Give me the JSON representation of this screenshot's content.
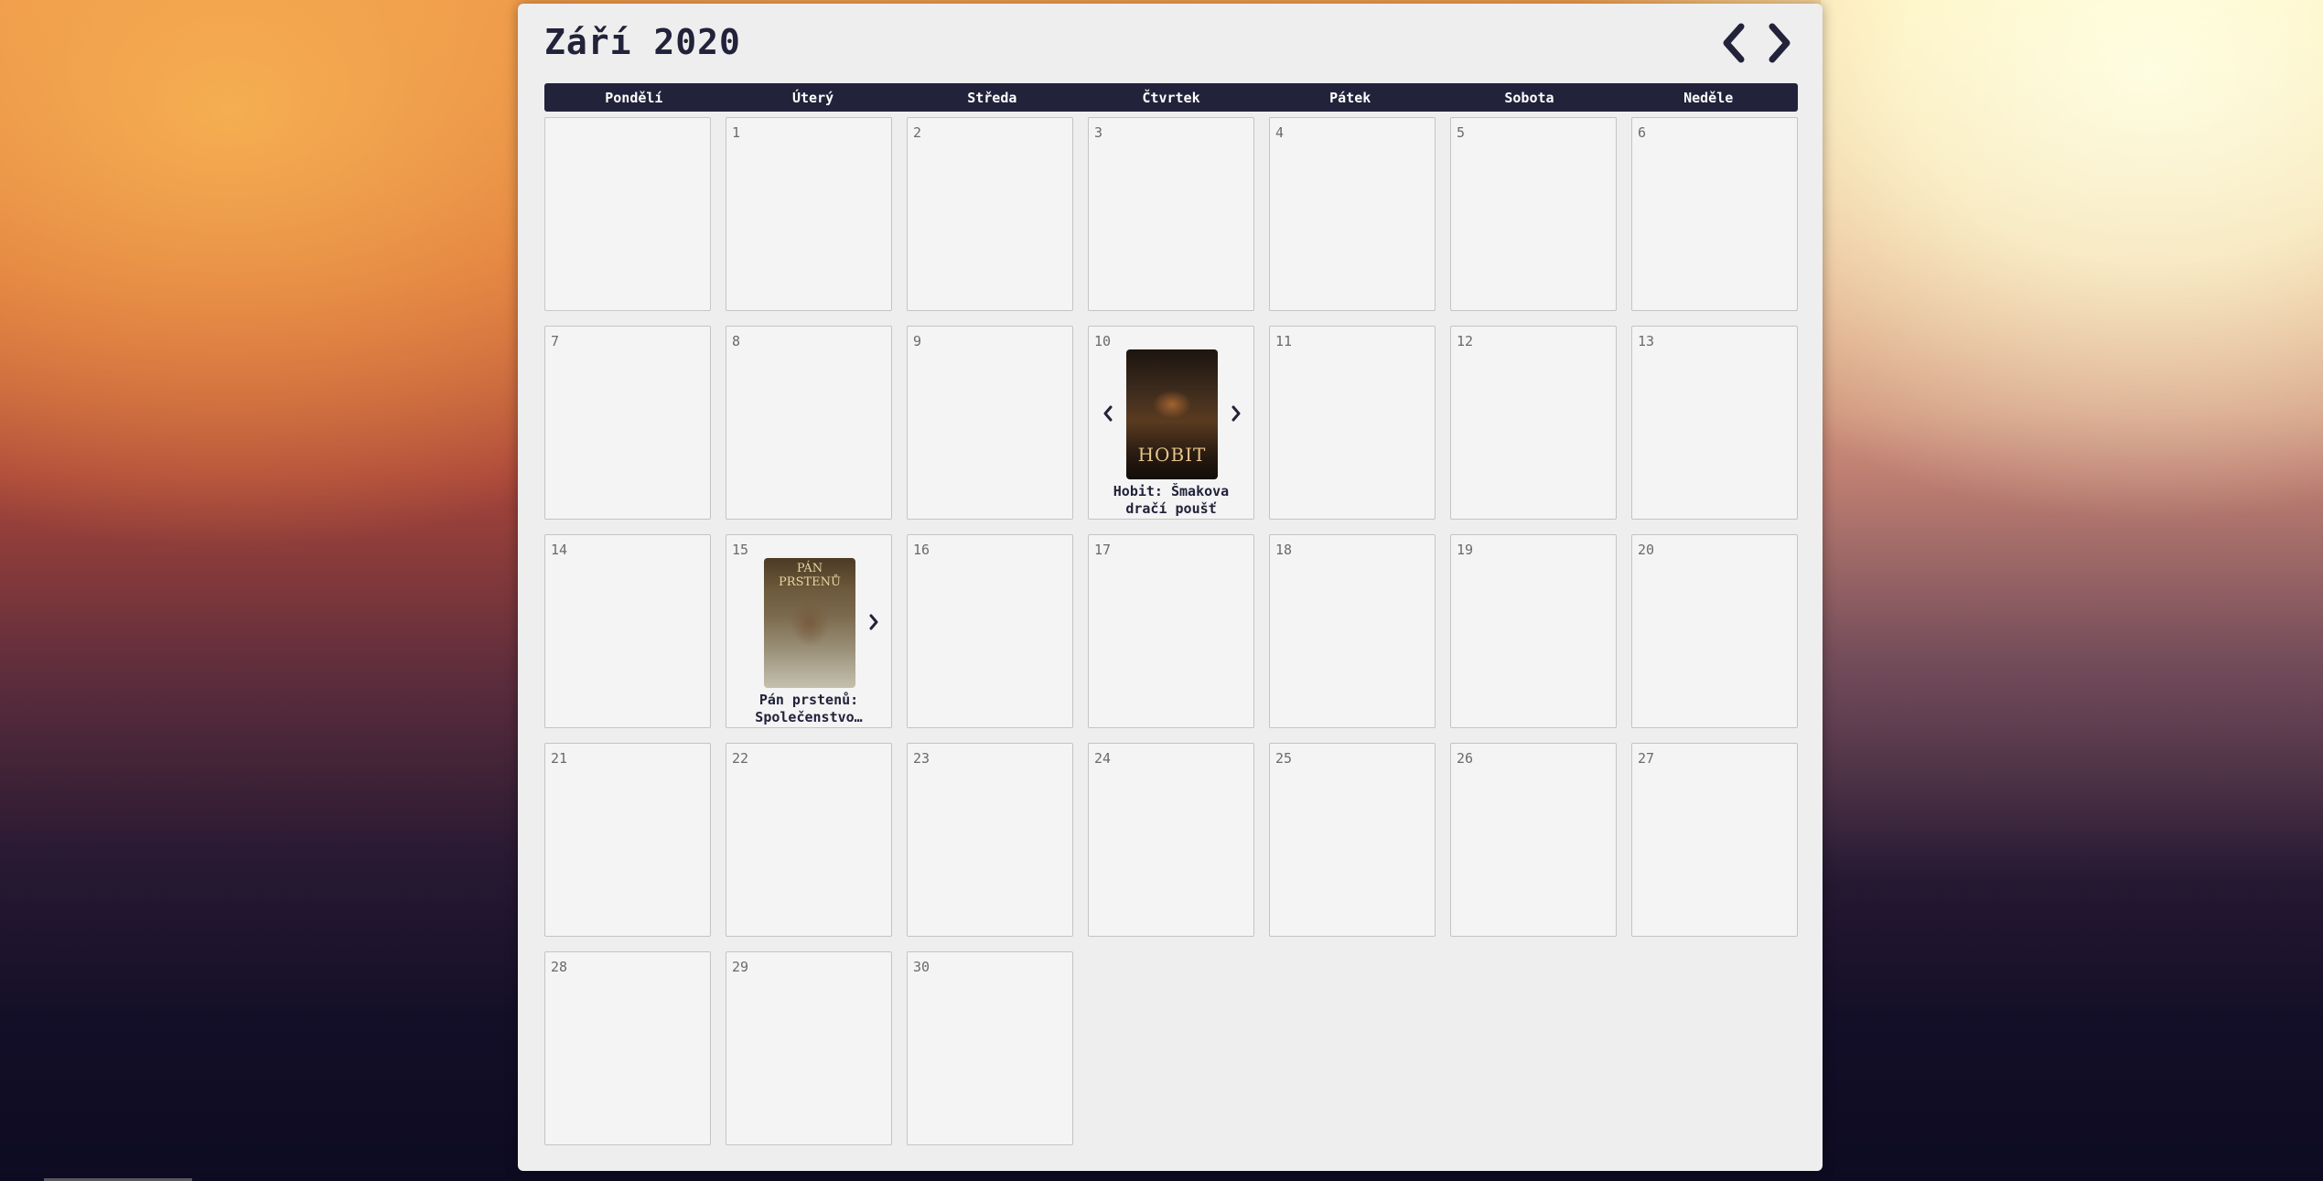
{
  "calendar": {
    "title": "Září 2020",
    "weekdays": [
      "Pondělí",
      "Úterý",
      "Středa",
      "Čtvrtek",
      "Pátek",
      "Sobota",
      "Neděle"
    ],
    "days": [
      "1",
      "2",
      "3",
      "4",
      "5",
      "6",
      "7",
      "8",
      "9",
      "10",
      "11",
      "12",
      "13",
      "14",
      "15",
      "16",
      "17",
      "18",
      "19",
      "20",
      "21",
      "22",
      "23",
      "24",
      "25",
      "26",
      "27",
      "28",
      "29",
      "30"
    ],
    "events": [
      {
        "day": "10",
        "title_line1": "Hobit: Šmakova",
        "title_line2": "dračí poušť",
        "poster_text": "HOBIT"
      },
      {
        "day": "15",
        "title_line1": "Pán prstenů:",
        "title_line2": "Společenstvo…",
        "poster_text": "PÁN PRSTENŮ"
      }
    ]
  },
  "colors": {
    "accent": "#22223b",
    "panel": "#eeeeee",
    "cell": "#f4f4f4"
  },
  "icons": {
    "prev": "chevron-left-icon",
    "next": "chevron-right-icon"
  }
}
